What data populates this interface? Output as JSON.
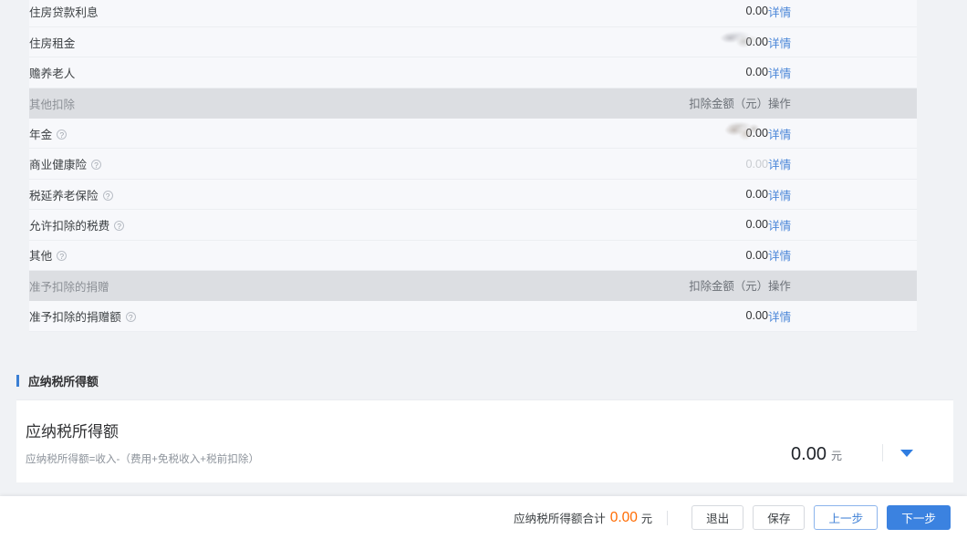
{
  "table": {
    "columns": {
      "item": "",
      "amount": "扣除金额（元）",
      "action": "操作"
    },
    "rows": [
      {
        "type": "data",
        "label": "住房贷款利息",
        "help": false,
        "amount": "0.00",
        "amount_state": "normal",
        "action": "详情"
      },
      {
        "type": "data",
        "label": "住房租金",
        "help": false,
        "amount": "0.00",
        "amount_state": "redacted",
        "action": "详情"
      },
      {
        "type": "data",
        "label": "赡养老人",
        "help": false,
        "amount": "0.00",
        "amount_state": "normal",
        "action": "详情"
      },
      {
        "type": "group",
        "label": "其他扣除",
        "help": false,
        "amount": "扣除金额（元）",
        "amount_state": "header",
        "action": "操作"
      },
      {
        "type": "data",
        "label": "年金",
        "help": true,
        "amount": "0.00",
        "amount_state": "redacted-warm",
        "action": "详情"
      },
      {
        "type": "data",
        "label": "商业健康险",
        "help": true,
        "amount": "0.00",
        "amount_state": "faded",
        "action": "详情"
      },
      {
        "type": "data",
        "label": "税延养老保险",
        "help": true,
        "amount": "0.00",
        "amount_state": "normal",
        "action": "详情"
      },
      {
        "type": "data",
        "label": "允许扣除的税费",
        "help": true,
        "amount": "0.00",
        "amount_state": "normal",
        "action": "详情"
      },
      {
        "type": "data",
        "label": "其他",
        "help": true,
        "amount": "0.00",
        "amount_state": "normal",
        "action": "详情"
      },
      {
        "type": "group",
        "label": "准予扣除的捐赠",
        "help": false,
        "amount": "扣除金额（元）",
        "amount_state": "header",
        "action": "操作"
      },
      {
        "type": "data",
        "label": "准予扣除的捐赠额",
        "help": true,
        "amount": "0.00",
        "amount_state": "normal",
        "action": "详情"
      }
    ]
  },
  "section": {
    "title": "应纳税所得额",
    "accent_color": "#3b7fd4"
  },
  "card": {
    "title": "应纳税所得额",
    "formula": "应纳税所得额=收入-（费用+免税收入+税前扣除）",
    "value": "0.00",
    "unit": "元",
    "caret_icon": "chevron-down-icon"
  },
  "footer": {
    "total_label": "应纳税所得额合计",
    "total_value": "0.00",
    "total_unit": "元",
    "total_color": "#ff6a00",
    "buttons": [
      {
        "label": "退出",
        "style": "plain"
      },
      {
        "label": "保存",
        "style": "plain"
      },
      {
        "label": "上一步",
        "style": "ghost"
      },
      {
        "label": "下一步",
        "style": "primary"
      }
    ]
  }
}
